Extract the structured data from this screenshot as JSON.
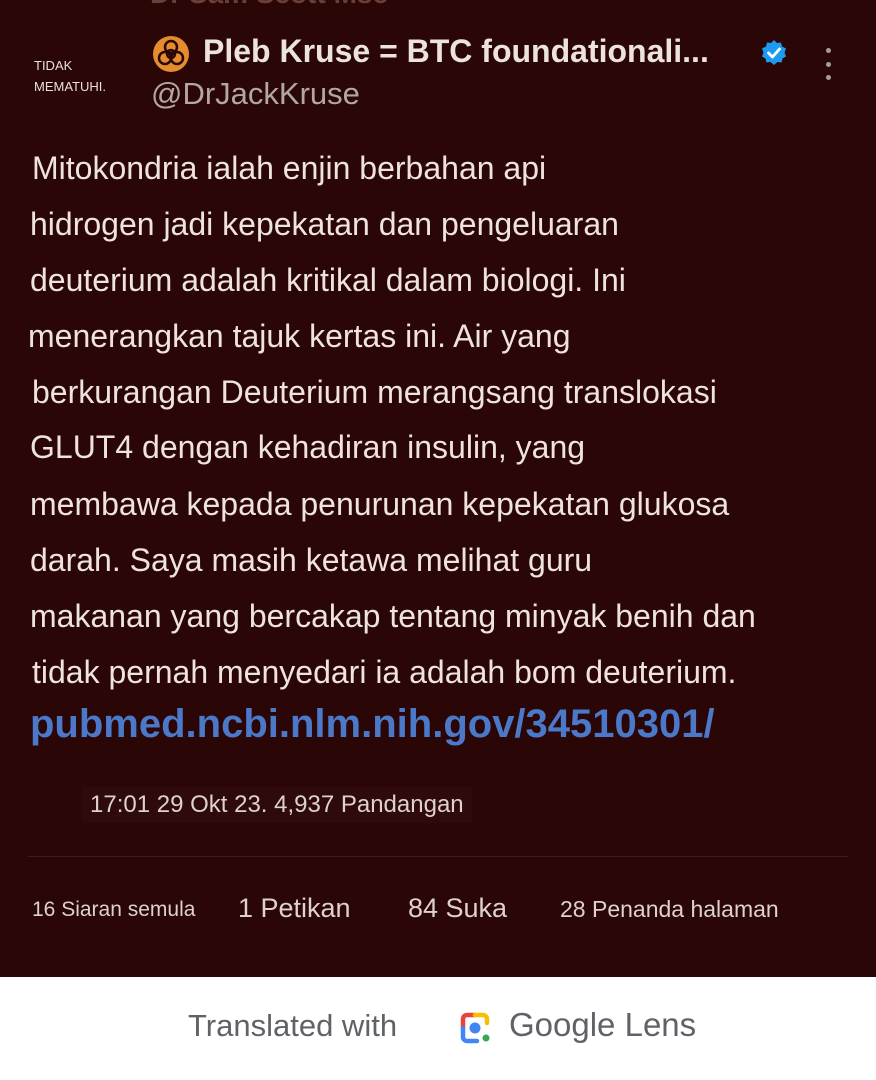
{
  "top_clipped_text": "Dr Sam Scott Msc",
  "tag": {
    "line1": "TIDAK",
    "line2": "MEMATUHI."
  },
  "author": {
    "name": "Pleb Kruse = BTC foundationali...",
    "handle": "@DrJackKruse",
    "avatar_icon": "biohazard-icon",
    "verified_icon": "verified-badge-icon",
    "verified_color": "#1d9bf0"
  },
  "body_lines": [
    "Mitokondria ialah enjin berbahan api",
    "hidrogen jadi kepekatan dan pengeluaran",
    "deuterium adalah kritikal dalam biologi. Ini",
    "menerangkan tajuk kertas ini. Air yang",
    "berkurangan Deuterium merangsang translokasi",
    "GLUT4 dengan kehadiran insulin, yang",
    "membawa kepada penurunan kepekatan glukosa",
    "darah. Saya masih ketawa melihat guru",
    "makanan yang bercakap tentang minyak benih dan",
    "tidak pernah menyedari ia adalah bom deuterium."
  ],
  "link": "pubmed.ncbi.nlm.nih.gov/34510301/",
  "meta": "17:01 29 Okt 23. 4,937 Pandangan",
  "stats": {
    "reposts": "16 Siaran semula",
    "quotes": "1 Petikan",
    "likes": "84 Suka",
    "bookmarks": "28 Penanda halaman"
  },
  "lens": {
    "prefix": "Translated with",
    "brand": "Google",
    "product": "Lens",
    "icon": "google-lens-icon"
  },
  "colors": {
    "background": "#2a0606",
    "link": "#4b78c8",
    "text": "#eee3df"
  }
}
